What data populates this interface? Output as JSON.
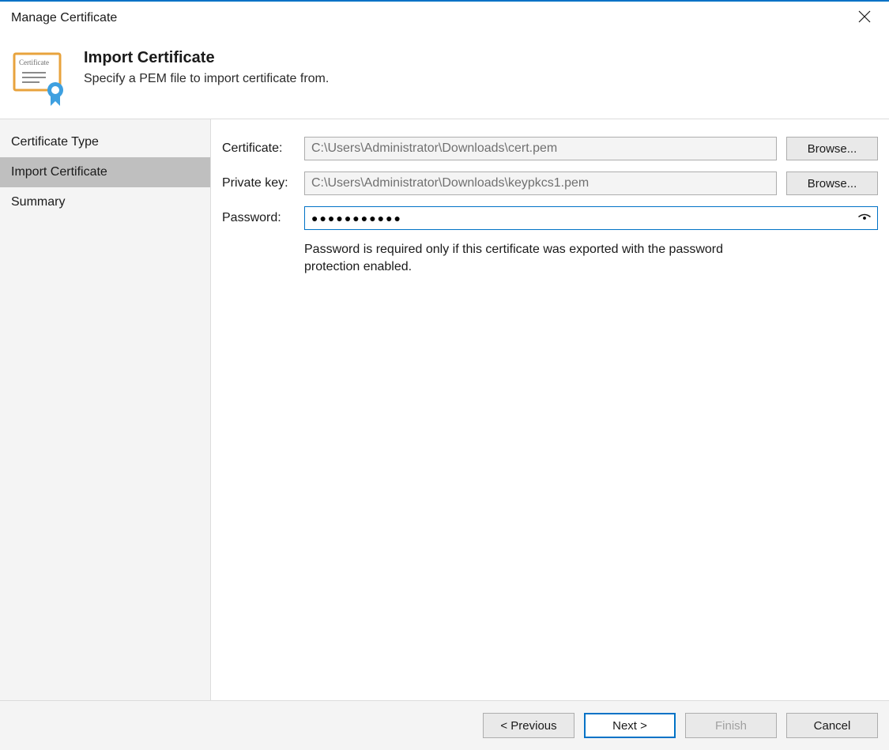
{
  "window": {
    "title": "Manage Certificate"
  },
  "header": {
    "title": "Import Certificate",
    "subtitle": "Specify a PEM file to import certificate from.",
    "icon_label": "Certificate"
  },
  "sidebar": {
    "items": [
      {
        "label": "Certificate Type",
        "active": false
      },
      {
        "label": "Import Certificate",
        "active": true
      },
      {
        "label": "Summary",
        "active": false
      }
    ]
  },
  "form": {
    "certificate_label": "Certificate:",
    "certificate_value": "C:\\Users\\Administrator\\Downloads\\cert.pem",
    "privatekey_label": "Private key:",
    "privatekey_value": "C:\\Users\\Administrator\\Downloads\\keypkcs1.pem",
    "password_label": "Password:",
    "password_value": "●●●●●●●●●●●",
    "browse_label": "Browse...",
    "hint": "Password is required only if this certificate was exported with the password protection enabled."
  },
  "footer": {
    "previous": "< Previous",
    "next": "Next >",
    "finish": "Finish",
    "cancel": "Cancel"
  }
}
